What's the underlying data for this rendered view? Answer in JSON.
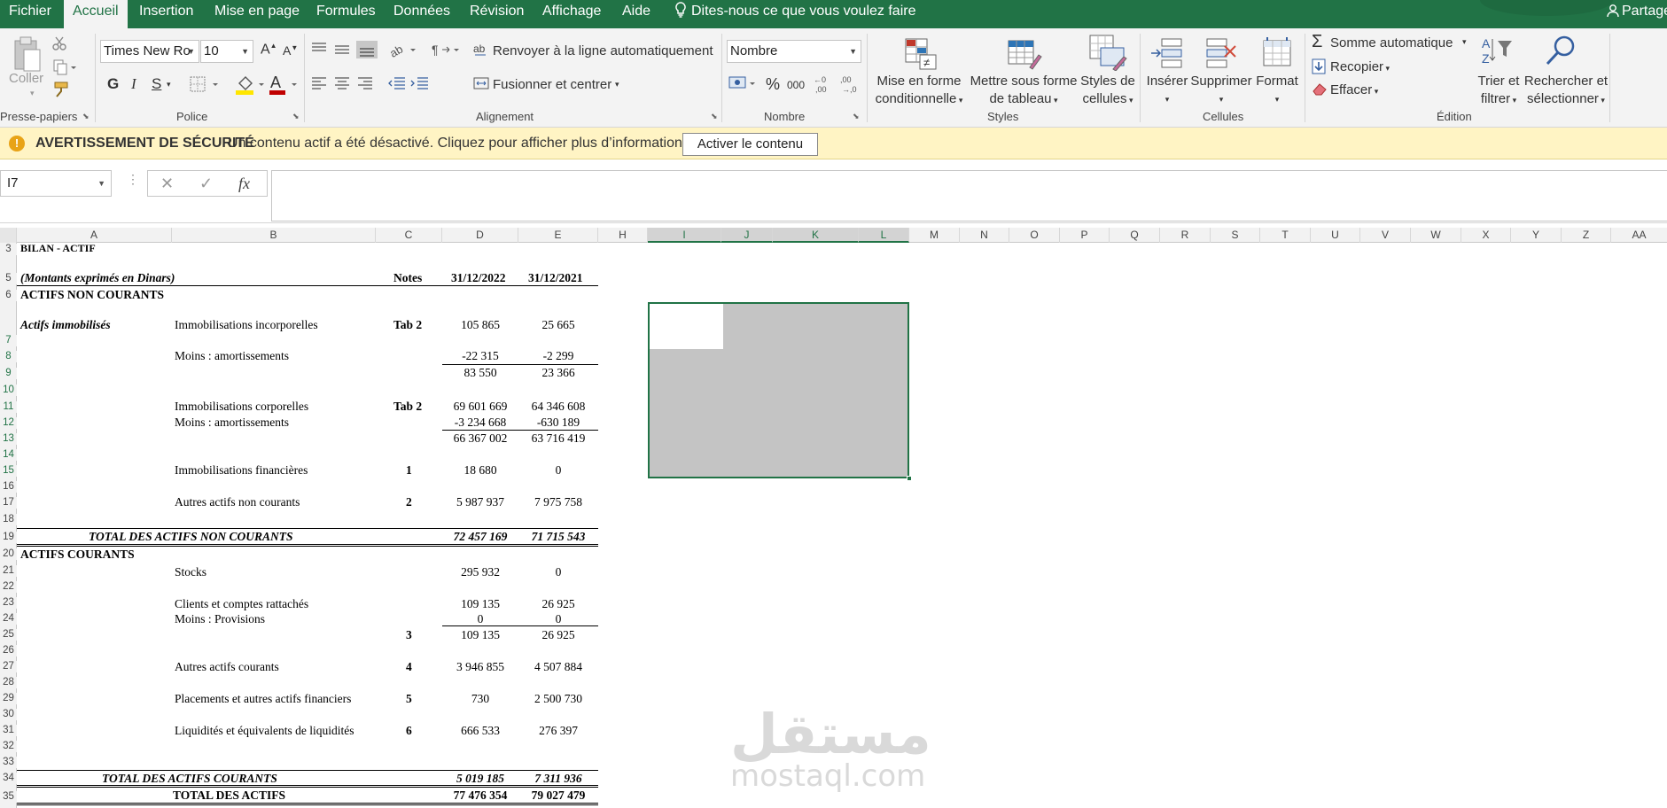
{
  "tabs": [
    "Fichier",
    "Accueil",
    "Insertion",
    "Mise en page",
    "Formules",
    "Données",
    "Révision",
    "Affichage",
    "Aide"
  ],
  "active_tab": "Accueil",
  "tell_me": "Dites-nous ce que vous voulez faire",
  "share": "Partage",
  "ribbon": {
    "paste": "Coller",
    "groups": {
      "clipboard": "Presse-papiers",
      "font": "Police",
      "alignment": "Alignement",
      "number": "Nombre",
      "styles": "Styles",
      "cells": "Cellules",
      "editing": "Édition"
    },
    "font_name": "Times New Ro",
    "font_size": "10",
    "bold": "G",
    "italic": "I",
    "underline": "S",
    "wrap_text": "Renvoyer à la ligne automatiquement",
    "merge_center": "Fusionner et centrer",
    "number_format": "Nombre",
    "percent": "%",
    "thousands": "000",
    "cond_format": [
      "Mise en forme",
      "conditionnelle"
    ],
    "format_table": [
      "Mettre sous forme",
      "de tableau"
    ],
    "cell_styles": [
      "Styles de",
      "cellules"
    ],
    "insert": "Insérer",
    "delete": "Supprimer",
    "format": "Format",
    "autosum": "Somme automatique",
    "fill": "Recopier",
    "clear": "Effacer",
    "sort_filter": [
      "Trier et",
      "filtrer"
    ],
    "find_select": [
      "Rechercher et",
      "sélectionner"
    ]
  },
  "security": {
    "title": "AVERTISSEMENT DE SÉCURITÉ",
    "message": "Un contenu actif a été désactivé. Cliquez pour afficher plus d’informations.",
    "button": "Activer le contenu"
  },
  "formula_bar": {
    "name_box": "I7",
    "cancel": "✕",
    "enter": "✓",
    "fx": "fx",
    "content": ""
  },
  "columns": [
    "A",
    "B",
    "C",
    "D",
    "E",
    "H",
    "I",
    "J",
    "K",
    "L",
    "M",
    "N",
    "O",
    "P",
    "Q",
    "R",
    "S",
    "T",
    "U",
    "V",
    "W",
    "X",
    "Y",
    "Z",
    "AA"
  ],
  "rows": [
    "3",
    "5",
    "6",
    "7",
    "8",
    "9",
    "10",
    "11",
    "12",
    "13",
    "14",
    "15",
    "16",
    "17",
    "18",
    "19",
    "20",
    "21",
    "22",
    "23",
    "24",
    "25",
    "26",
    "27",
    "28",
    "29",
    "30",
    "31",
    "32",
    "33",
    "34",
    "35"
  ],
  "sheet": {
    "r3_title": "BILAN - ACTIF",
    "r5_note": "(Montants exprimés en Dinars)",
    "r5_notes": "Notes",
    "r5_d": "31/12/2022",
    "r5_e": "31/12/2021",
    "r6": "ACTIFS NON COURANTS",
    "r7_a": "Actifs immobilisés",
    "r7_b": "Immobilisations incorporelles",
    "r7_c": "Tab 2",
    "r7_d": "105 865",
    "r7_e": "25 665",
    "r8_b": "Moins : amortissements",
    "r8_d": "-22 315",
    "r8_e": "-2 299",
    "r9_d": "83 550",
    "r9_e": "23 366",
    "r11_b": "Immobilisations corporelles",
    "r11_c": "Tab 2",
    "r11_d": "69 601 669",
    "r11_e": "64 346 608",
    "r12_b": "Moins : amortissements",
    "r12_d": "-3 234 668",
    "r12_e": "-630 189",
    "r13_d": "66 367 002",
    "r13_e": "63 716 419",
    "r15_b": "Immobilisations financières",
    "r15_c": "1",
    "r15_d": "18 680",
    "r15_e": "0",
    "r17_b": "Autres actifs non courants",
    "r17_c": "2",
    "r17_d": "5 987 937",
    "r17_e": "7 975 758",
    "r19_b": "TOTAL DES ACTIFS NON COURANTS",
    "r19_d": "72 457 169",
    "r19_e": "71 715 543",
    "r20": "ACTIFS COURANTS",
    "r21_b": "Stocks",
    "r21_d": "295 932",
    "r21_e": "0",
    "r23_b": "Clients et comptes rattachés",
    "r23_d": "109 135",
    "r23_e": "26 925",
    "r24_b": "Moins : Provisions",
    "r24_d": "0",
    "r24_e": "0",
    "r25_c": "3",
    "r25_d": "109 135",
    "r25_e": "26 925",
    "r27_b": "Autres actifs courants",
    "r27_c": "4",
    "r27_d": "3 946 855",
    "r27_e": "4 507 884",
    "r29_b": "Placements et autres actifs financiers",
    "r29_c": "5",
    "r29_d": "730",
    "r29_e": "2 500 730",
    "r31_b": "Liquidités et équivalents de liquidités",
    "r31_c": "6",
    "r31_d": "666 533",
    "r31_e": "276 397",
    "r34_b": "TOTAL DES ACTIFS  COURANTS",
    "r34_d": "5 019 185",
    "r34_e": "7 311 936",
    "r35_b": "TOTAL DES ACTIFS",
    "r35_d": "77 476 354",
    "r35_e": "79 027 479"
  },
  "watermark": {
    "arabic": "مستقل",
    "latin": "mostaql.com"
  },
  "colors": {
    "accent": "#217346",
    "security_bg": "#fff4c4",
    "selection_fill": "#c4c4c4"
  }
}
